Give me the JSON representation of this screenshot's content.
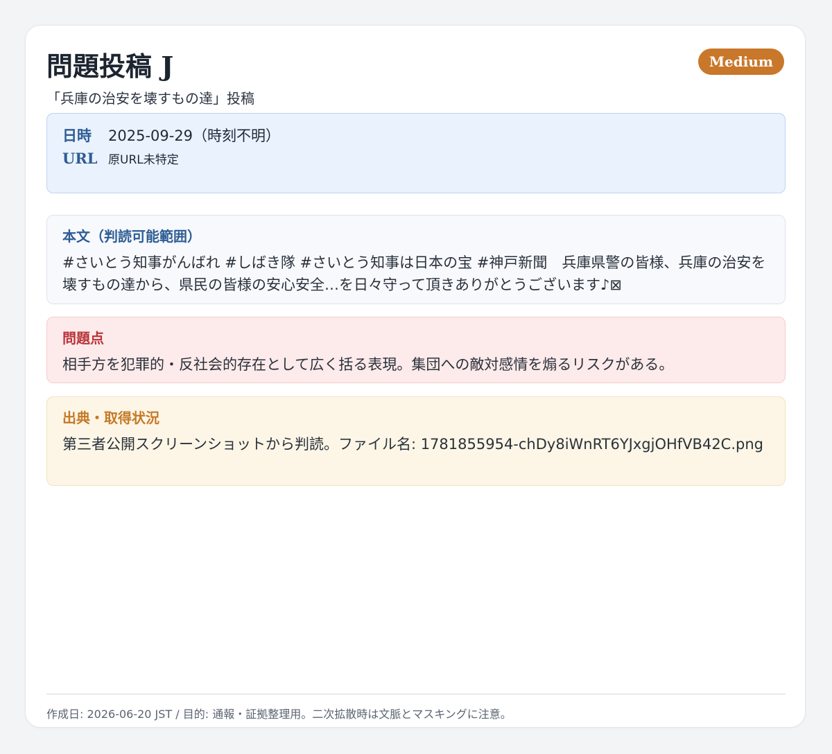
{
  "header": {
    "title": "問題投稿 J",
    "subtitle": "「兵庫の治安を壊すもの達」投稿",
    "badge": "Medium"
  },
  "meta": {
    "datetime_label": "日時",
    "datetime_value": "2025-09-29（時刻不明）",
    "url_label": "URL",
    "url_value": "原URL未特定"
  },
  "body_section": {
    "title": "本文（判読可能範囲）",
    "text": "#さいとう知事がんばれ #しばき隊 #さいとう知事は日本の宝 #神戸新聞　兵庫県警の皆様、兵庫の治安を壊すもの達から、県民の皆様の安心安全…を日々守って頂きありがとうございます♪⊠"
  },
  "issue_section": {
    "title": "問題点",
    "text": "相手方を犯罪的・反社会的存在として広く括る表現。集団への敵対感情を煽るリスクがある。"
  },
  "source_section": {
    "title": "出典・取得状況",
    "text": "第三者公開スクリーンショットから判読。ファイル名: 1781855954-chDy8iWnRT6YJxgjOHfVB42C.png"
  },
  "footer": {
    "text": "作成日: 2026-06-20 JST / 目的: 通報・証拠整理用。二次拡散時は文脈とマスキングに注意。"
  },
  "colors": {
    "badge": "#c9772a",
    "meta_bg": "#eaf2fe",
    "issue_bg": "#fdeaea",
    "source_bg": "#fdf6e6",
    "label_blue": "#2d5c93",
    "label_red": "#b8323a",
    "label_orange": "#c47a28"
  }
}
